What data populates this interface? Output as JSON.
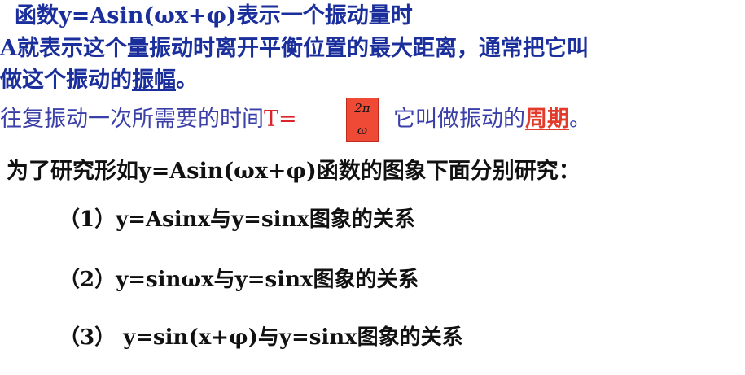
{
  "lines": {
    "line1": "函数y=Asin(ωx+φ)表示一个振动量时",
    "line2": "A就表示这个量振动时离开平衡位置的最大距离，通常把它叫",
    "line3_prefix": "做这个振动的",
    "line3_term": "振幅",
    "line3_suffix": "。"
  },
  "period": {
    "prefix": "往复振动一次所需要的时间",
    "formula_label": "T=",
    "numerator": "2π",
    "denominator": "ω",
    "middle": "它叫做振动的",
    "term": "周期",
    "suffix": "。"
  },
  "study": {
    "title": "为了研究形如y=Asin(ωx+φ)函数的图象下面分别研究：",
    "items": [
      "（1）y=Asinx与y=sinx图象的关系",
      "（2）y=sinωx与y=sinx图象的关系",
      "（3） y=sin(x+φ)与y=sinx图象的关系"
    ]
  },
  "colors": {
    "primary": "#1b2f9c",
    "secondary": "#3b3fa8",
    "accent": "#d9252a",
    "box": "#ef4a36",
    "text": "#111111"
  }
}
